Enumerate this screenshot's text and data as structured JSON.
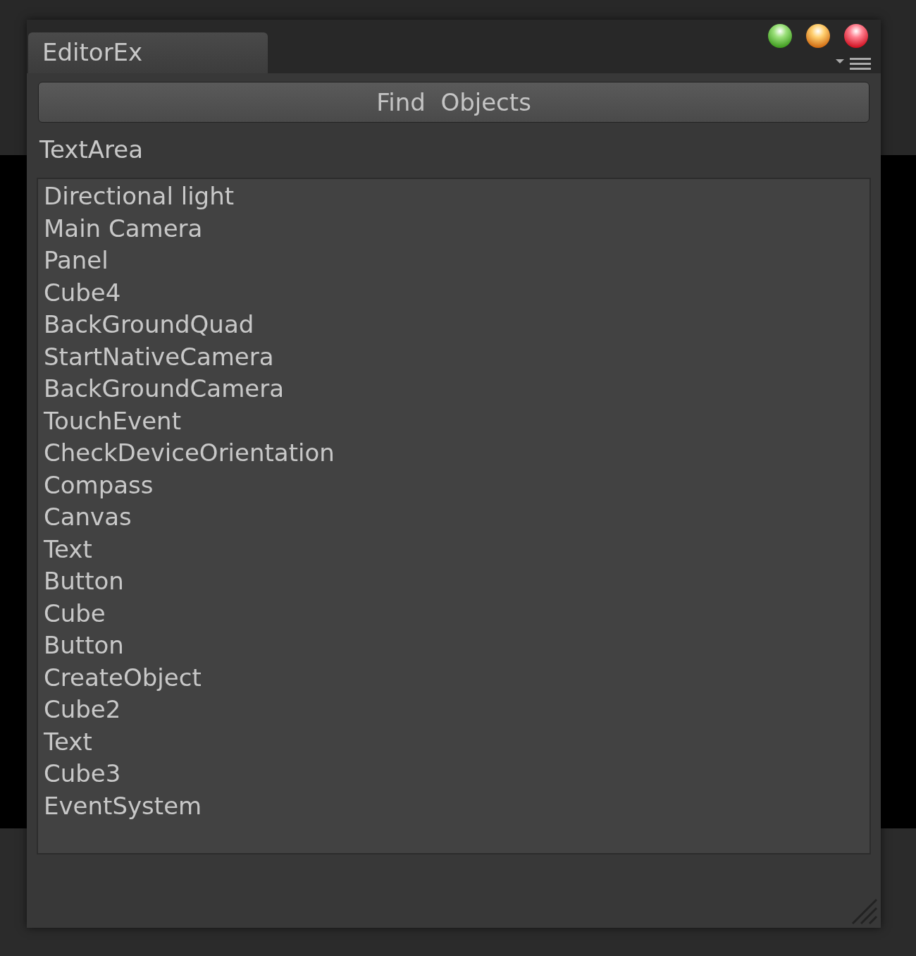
{
  "window": {
    "tab": "EditorEx"
  },
  "find_button": {
    "label": "Find  Objects"
  },
  "text_area": {
    "label": "TextArea",
    "lines": [
      "Directional light",
      "Main Camera",
      "Panel",
      "Cube4",
      "BackGroundQuad",
      "StartNativeCamera",
      "BackGroundCamera",
      "TouchEvent",
      "CheckDeviceOrientation",
      "Compass",
      "Canvas",
      "Text",
      "Button",
      "Cube",
      "Button",
      "CreateObject",
      "Cube2",
      "Text",
      "Cube3",
      "EventSystem"
    ]
  }
}
